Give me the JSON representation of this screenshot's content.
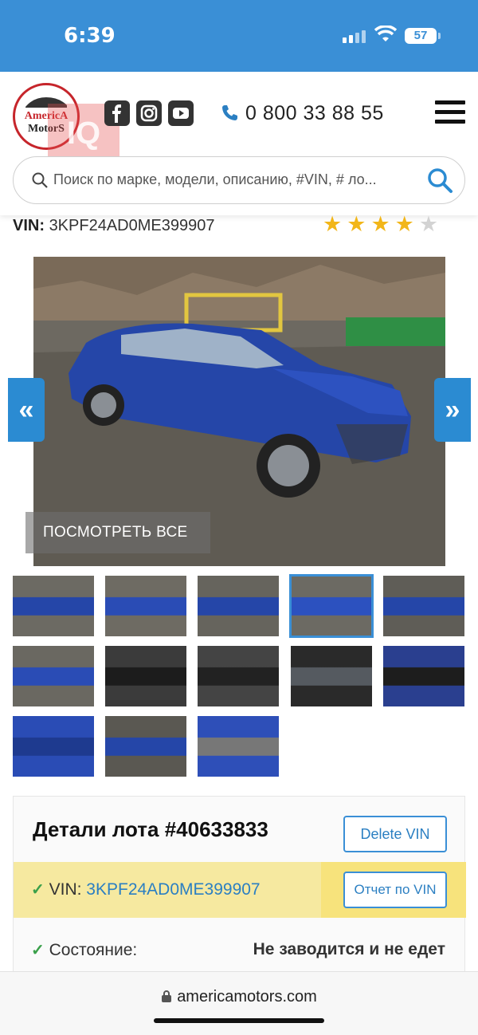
{
  "status": {
    "time": "6:39",
    "battery": "57"
  },
  "header": {
    "logo_line1": "AmericA",
    "logo_line2": "MotorS",
    "watermark": "IQ",
    "phone": "0 800 33 88 55",
    "search_placeholder": "Поиск по марке, модели, описанию, #VIN, # ло..."
  },
  "vin_line": {
    "label": "VIN:",
    "value": "3KPF24AD0ME399907"
  },
  "rating": {
    "stars": 4,
    "max": 5,
    "color": "#f2b619"
  },
  "gallery": {
    "view_all": "ПОСМОТРЕТЬ ВСЕ",
    "prev_arrow": "«",
    "next_arrow": "»",
    "selected_thumb_index": 3,
    "thumbs": [
      "exterior-front-left",
      "exterior-rear-left",
      "exterior-rear-right",
      "exterior-side-right",
      "exterior-front",
      "exterior-rear",
      "interior-front-seats",
      "interior-dashboard",
      "interior-cluster",
      "interior-rear-seats",
      "damaged-hood",
      "damaged-part",
      "door-label"
    ]
  },
  "details": {
    "title": "Детали лота #40633833",
    "delete_vin": "Delete VIN",
    "vin_label": "VIN:",
    "vin_value": "3KPF24AD0ME399907",
    "vin_report": "Отчет по VIN",
    "condition_label": "Состояние:",
    "condition_value": "Не заводится и не едет"
  },
  "browser": {
    "url": "americamotors.com"
  },
  "colors": {
    "accent": "#3a8fd6",
    "car_blue": "#2546a8",
    "highlight": "#f6e9a0"
  }
}
